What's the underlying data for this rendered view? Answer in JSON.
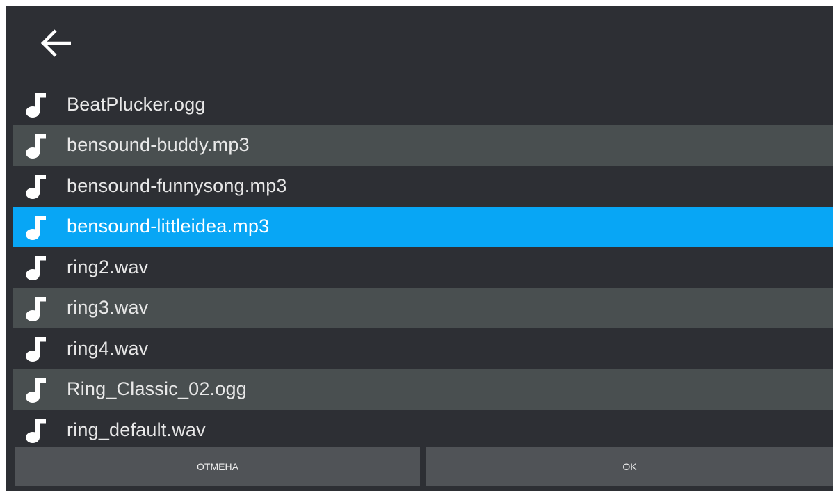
{
  "header": {
    "back_icon": "arrow-back-icon"
  },
  "files": [
    {
      "name": "BeatPlucker.ogg",
      "icon": "music-note-icon"
    },
    {
      "name": "bensound-buddy.mp3",
      "icon": "music-note-icon"
    },
    {
      "name": "bensound-funnysong.mp3",
      "icon": "music-note-icon"
    },
    {
      "name": "bensound-littleidea.mp3",
      "icon": "music-note-icon",
      "selected": true
    },
    {
      "name": "ring2.wav",
      "icon": "music-note-icon"
    },
    {
      "name": "ring3.wav",
      "icon": "music-note-icon"
    },
    {
      "name": "ring4.wav",
      "icon": "music-note-icon"
    },
    {
      "name": "Ring_Classic_02.ogg",
      "icon": "music-note-icon"
    },
    {
      "name": "ring_default.wav",
      "icon": "music-note-icon"
    }
  ],
  "buttons": {
    "cancel_label": "ОТМЕНА",
    "ok_label": "OK"
  },
  "colors": {
    "background": "#2d2f34",
    "row_alt": "#494f50",
    "row_selected": "#08a6f5",
    "button": "#505357",
    "text": "#e8e8e8"
  }
}
